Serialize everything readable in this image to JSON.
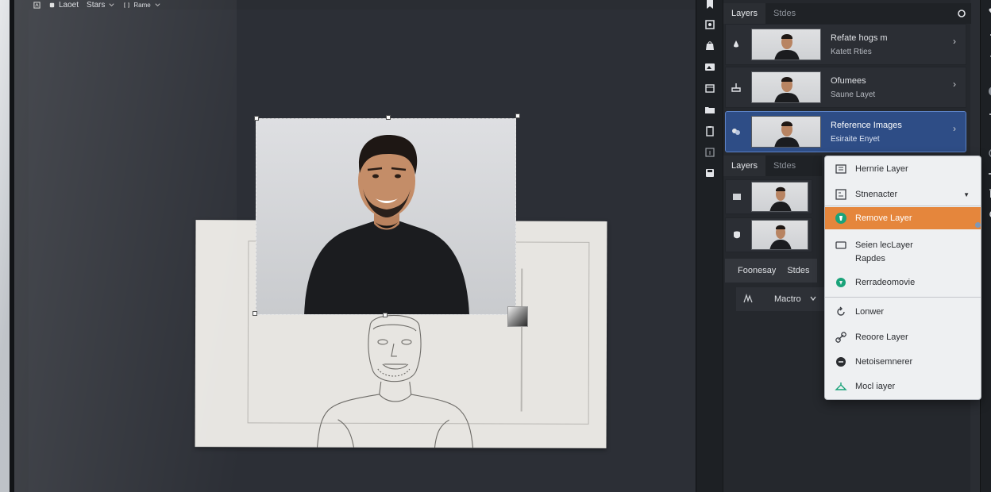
{
  "menubar": {
    "items": [
      "Laoet",
      "Stars",
      "Rame"
    ]
  },
  "panel": {
    "tabs_top": [
      "Layers",
      "Stdes"
    ],
    "layers": [
      {
        "title": "Refate hogs m",
        "sub": "Katett Rties"
      },
      {
        "title": "Ofumees",
        "sub": "Saune Layet"
      },
      {
        "title": "Reference Images",
        "sub": "Esiraite Enyet"
      }
    ],
    "tabs_mid": [
      "Layers",
      "Stdes"
    ],
    "bar2": [
      "Foonesay",
      "Stdes"
    ],
    "bar3_label": "Mactro",
    "chevron": "›"
  },
  "context_menu": {
    "items": [
      {
        "label": "Hernrie Layer",
        "icon": "layer-icon"
      },
      {
        "label": "Stnenacter",
        "icon": "layout-icon",
        "arrow": "▼"
      },
      {
        "label": "Remove Layer",
        "icon": "remove-icon",
        "highlight": true
      },
      {
        "label": "Seien lecLayer",
        "sub": "Rapdes",
        "icon": "rectangle-icon"
      },
      {
        "label": "Rerradeomovie",
        "icon": "teal-dot-icon"
      },
      {
        "label": "Lonwer",
        "icon": "rotate-icon"
      },
      {
        "label": "Reoore Layer",
        "icon": "link-icon"
      },
      {
        "label": "Netoisemnerer",
        "icon": "shape-icon"
      },
      {
        "label": "Mocl iayer",
        "icon": "hanger-icon"
      }
    ]
  },
  "colors": {
    "selected_row": "#2e4d86",
    "highlight": "#e5863c",
    "accent_teal": "#1aa37a"
  }
}
